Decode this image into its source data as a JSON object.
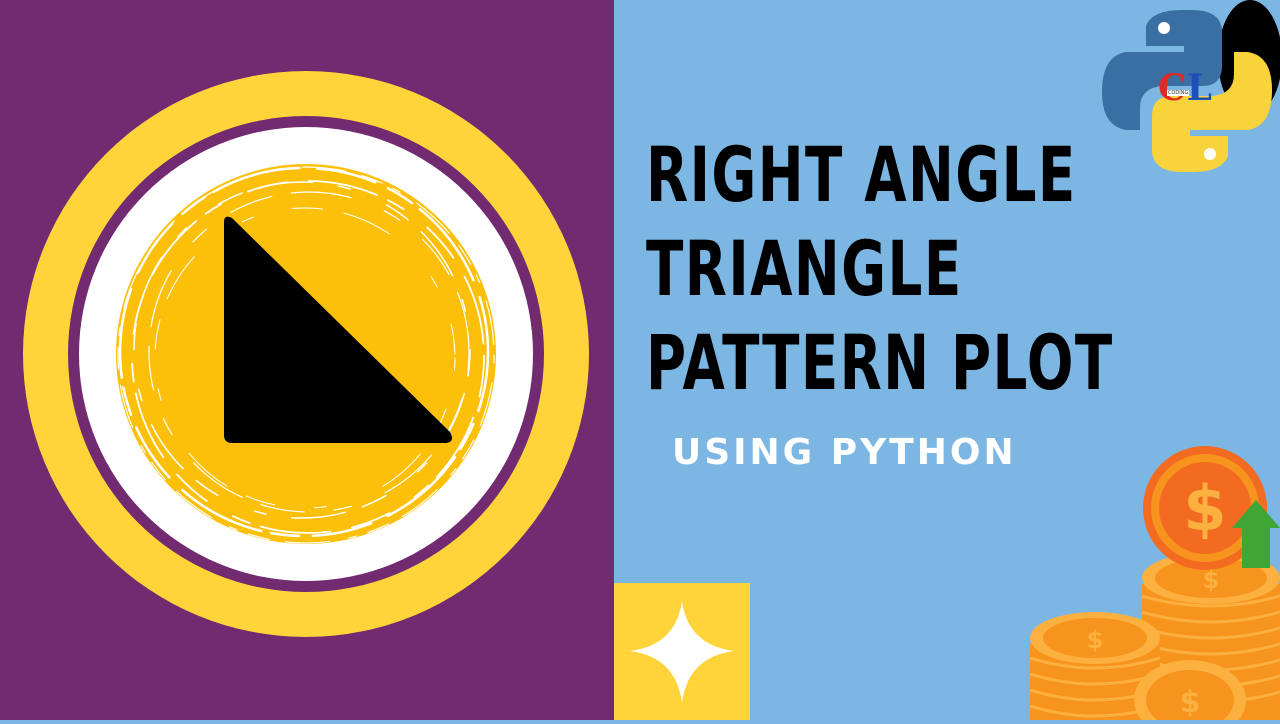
{
  "title": {
    "line1": "RIGHT ANGLE",
    "line2": "TRIANGLE",
    "line3": "PATTERN PLOT"
  },
  "subtitle": "USING PYTHON",
  "logo": {
    "letter_c": "C",
    "letter_l": "L",
    "tag": "CODING"
  },
  "coins": {
    "symbol": "$"
  },
  "icons": {
    "emblem": "right-triangle-icon",
    "python": "python-logo-icon",
    "sparkle": "sparkle-star-icon",
    "arrow": "green-up-arrow-icon",
    "coins": "coin-stack-icon"
  },
  "colors": {
    "purple": "#722a70",
    "sky": "#7cb6e3",
    "yellow": "#ffd43a",
    "amber": "#fdc00a",
    "python_blue": "#3a6fa3",
    "python_yellow": "#f8d33c",
    "coin_orange": "#f7941d",
    "arrow_green": "#3fa535"
  }
}
